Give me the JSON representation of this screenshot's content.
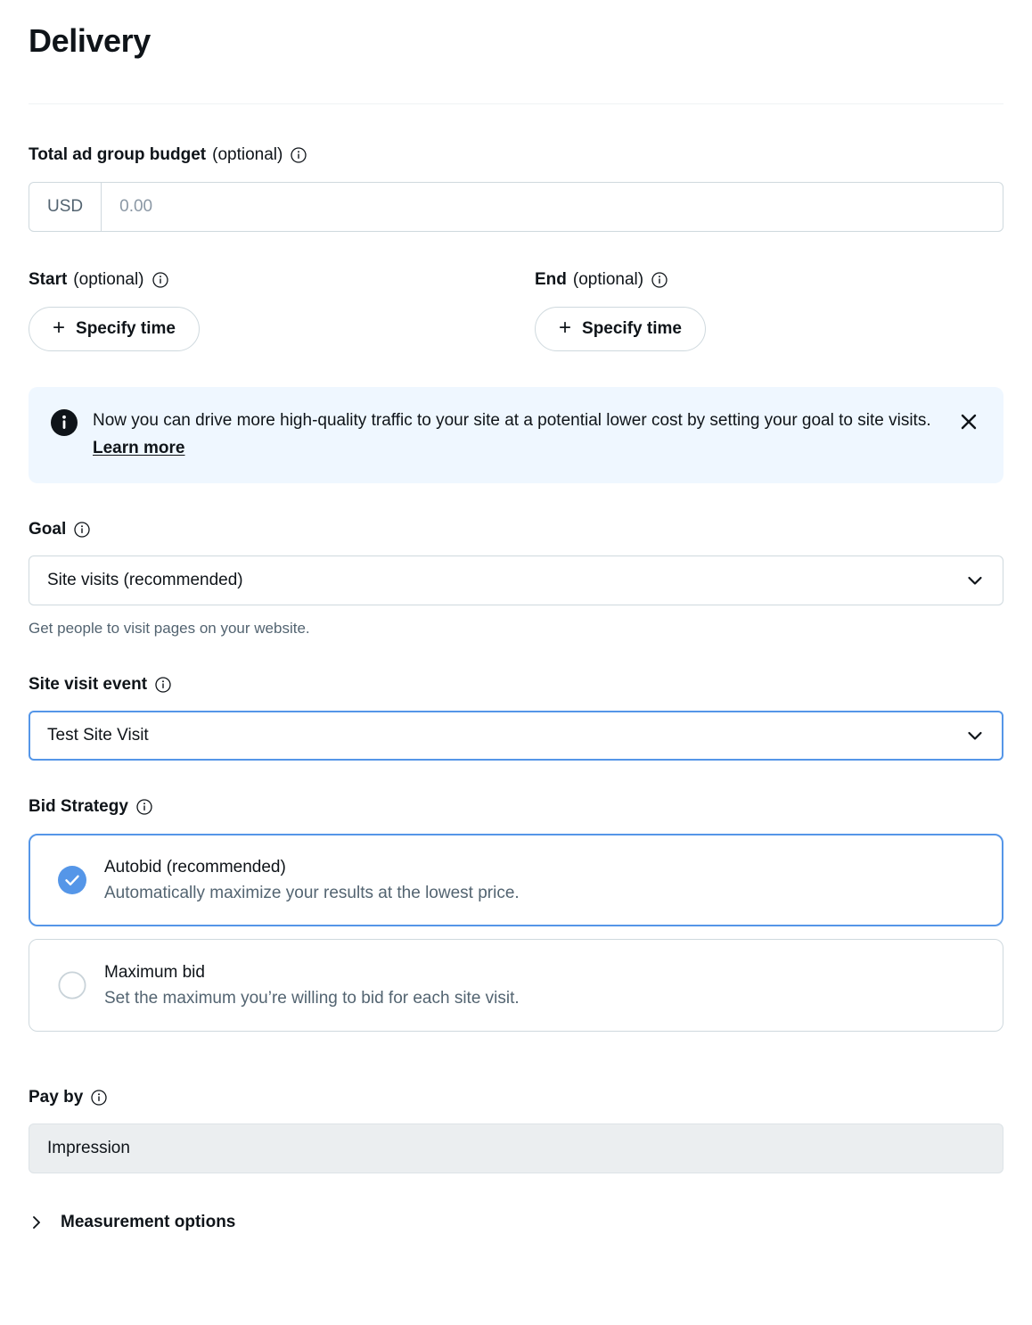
{
  "header": {
    "title": "Delivery"
  },
  "budget": {
    "label": "Total ad group budget",
    "optional_suffix": "(optional)",
    "currency": "USD",
    "value": "",
    "placeholder": "0.00"
  },
  "schedule": {
    "start": {
      "label": "Start",
      "optional_suffix": "(optional)",
      "button_label": "Specify time",
      "plus": "+"
    },
    "end": {
      "label": "End",
      "optional_suffix": "(optional)",
      "button_label": "Specify time",
      "plus": "+"
    }
  },
  "banner": {
    "text": "Now you can drive more high-quality traffic to your site at a potential lower cost by setting your goal to site visits.",
    "link_label": "Learn more",
    "icon": "info-filled-icon",
    "close_icon": "close-icon",
    "background_color": "#eff7ff"
  },
  "goal": {
    "label": "Goal",
    "selected": "Site visits (recommended)",
    "helper": "Get people to visit pages on your website."
  },
  "site_visit_event": {
    "label": "Site visit event",
    "selected": "Test Site Visit",
    "focused": true,
    "focus_color": "#5596e8"
  },
  "bid_strategy": {
    "label": "Bid Strategy",
    "options": [
      {
        "title": "Autobid (recommended)",
        "description": "Automatically maximize your results at the lowest price.",
        "selected": true
      },
      {
        "title": "Maximum bid",
        "description": "Set the maximum you’re willing to bid for each site visit.",
        "selected": false
      }
    ],
    "selected_color": "#5596e8"
  },
  "pay_by": {
    "label": "Pay by",
    "value": "Impression",
    "disabled": true
  },
  "measurement": {
    "label": "Measurement options",
    "expanded": false,
    "icon": "chevron-right-icon"
  }
}
